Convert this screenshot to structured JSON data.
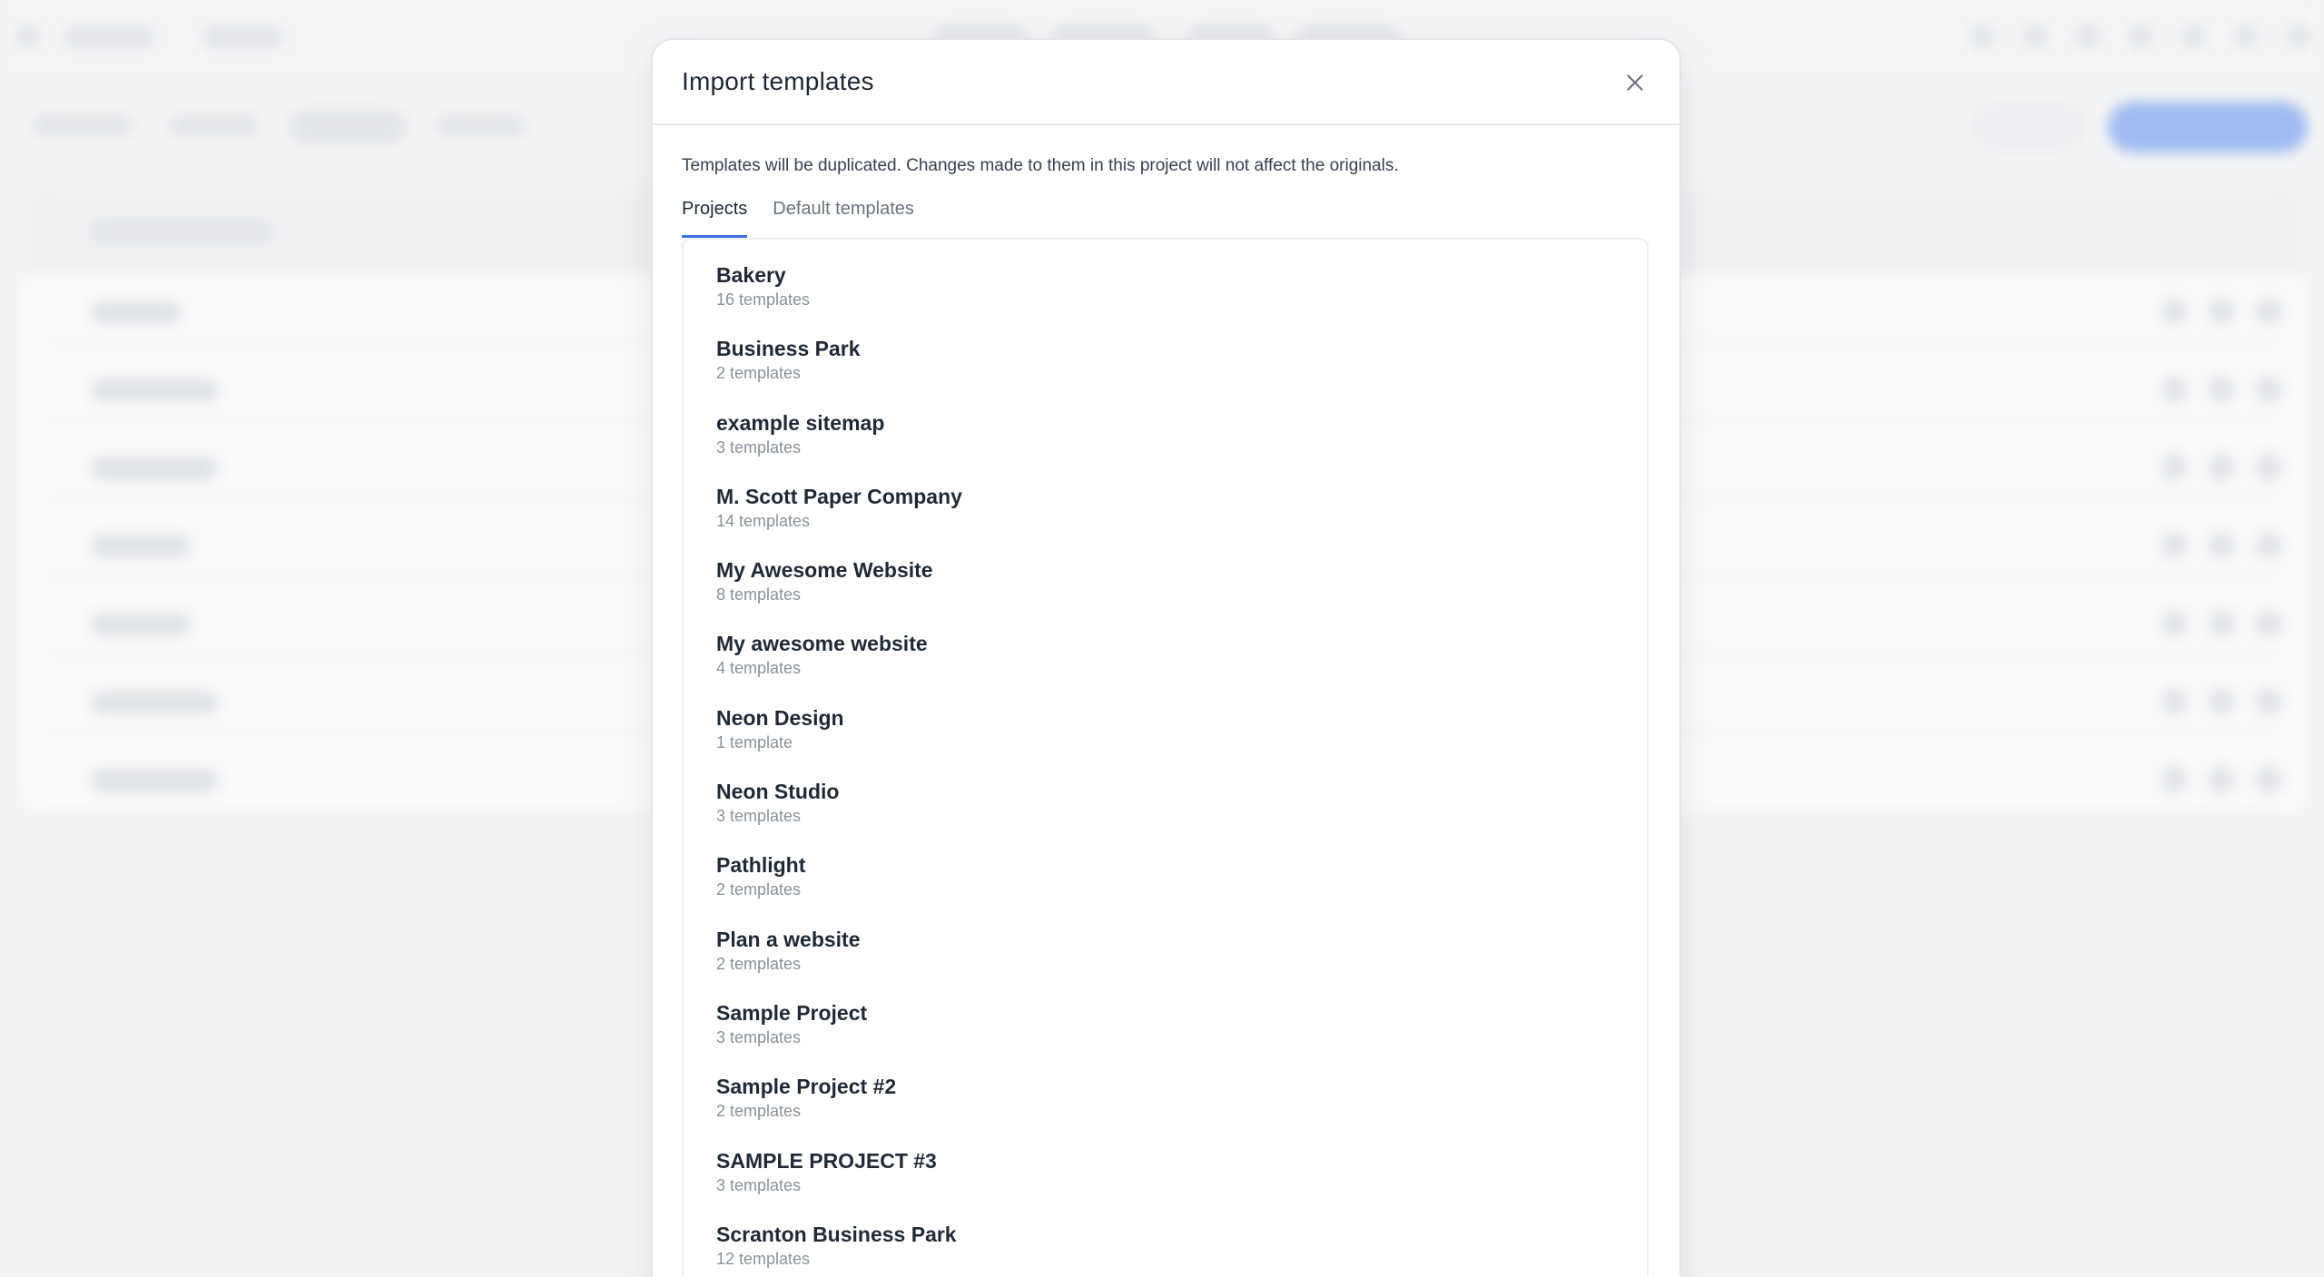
{
  "modal": {
    "title": "Import templates",
    "notice": "Templates will be duplicated. Changes made to them in this project will not affect the originals.",
    "tabs": [
      {
        "label": "Projects",
        "active": true
      },
      {
        "label": "Default templates",
        "active": false
      }
    ],
    "projects": [
      {
        "name": "Bakery",
        "count": "16 templates"
      },
      {
        "name": "Business Park",
        "count": "2 templates"
      },
      {
        "name": "example sitemap",
        "count": "3 templates"
      },
      {
        "name": "M. Scott Paper Company",
        "count": "14 templates"
      },
      {
        "name": "My Awesome Website",
        "count": "8 templates"
      },
      {
        "name": "My awesome website",
        "count": "4 templates"
      },
      {
        "name": "Neon Design",
        "count": "1 template"
      },
      {
        "name": "Neon Studio",
        "count": "3 templates"
      },
      {
        "name": "Pathlight",
        "count": "2 templates"
      },
      {
        "name": "Plan a website",
        "count": "2 templates"
      },
      {
        "name": "Sample Project",
        "count": "3 templates"
      },
      {
        "name": "Sample Project #2",
        "count": "2 templates"
      },
      {
        "name": "SAMPLE PROJECT #3",
        "count": "3 templates"
      },
      {
        "name": "Scranton Business Park",
        "count": "12 templates"
      }
    ]
  },
  "icons": {
    "close": "close-icon"
  },
  "colors": {
    "accent": "#3b6fdc",
    "background": "#f3f4f5",
    "modal": "#ffffff"
  }
}
